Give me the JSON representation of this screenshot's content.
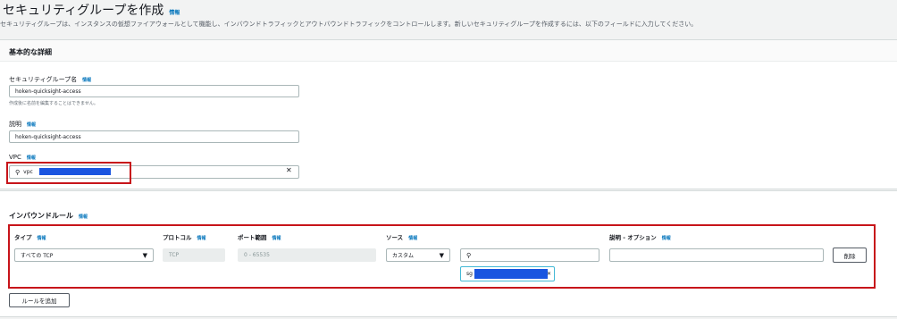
{
  "page": {
    "title": "セキュリティグループを作成",
    "title_info": "情報",
    "description": "セキュリティグループは、インスタンスの仮想ファイアウォールとして機能し、インバウンドトラフィックとアウトバウンドトラフィックをコントロールします。新しいセキュリティグループを作成するには、以下のフィールドに入力してください。"
  },
  "basic": {
    "heading": "基本的な詳細",
    "sg_name_label": "セキュリティグループ名",
    "sg_name_info": "情報",
    "sg_name_value": "hoken-quicksight-access",
    "sg_name_hint": "作成後に名前を編集することはできません。",
    "desc_label": "説明",
    "desc_info": "情報",
    "desc_value": "hoken-quicksight-access",
    "vpc_label": "VPC",
    "vpc_info": "情報",
    "vpc_value": "vpc"
  },
  "inbound": {
    "heading": "インバウンドルール",
    "heading_info": "情報",
    "columns": {
      "type": "タイプ",
      "protocol": "プロトコル",
      "port_range": "ポート範囲",
      "source": "ソース",
      "description": "説明 - オプション",
      "info": "情報"
    },
    "rule": {
      "type": "すべての TCP",
      "protocol": "TCP",
      "port_range": "0 - 65535",
      "source_type": "カスタム",
      "source_search": "",
      "source_chip": "sg",
      "description": ""
    },
    "delete_label": "削除",
    "add_rule_label": "ルールを追加"
  },
  "icons": {
    "search": "⚲",
    "clear": "✕",
    "caret": "▼"
  },
  "colors": {
    "link": "#0073bb",
    "highlight": "#c7141a",
    "redaction": "#1a55e0"
  }
}
